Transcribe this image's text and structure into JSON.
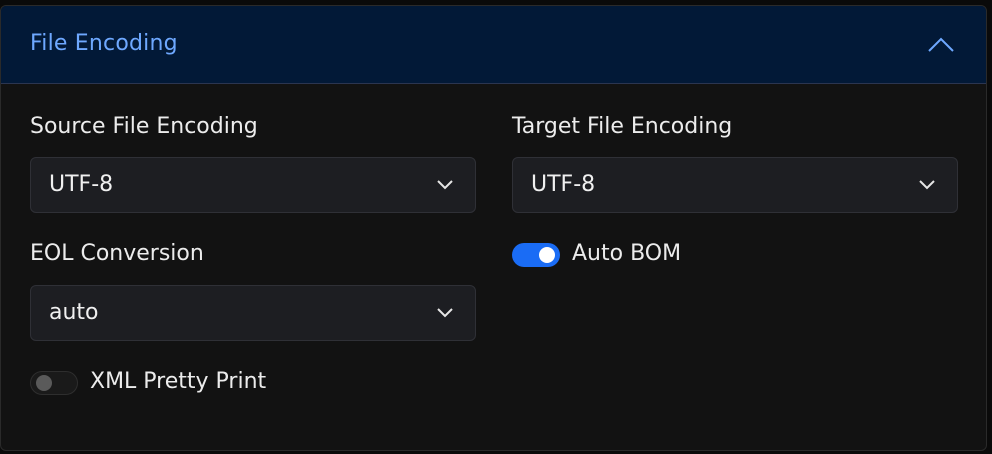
{
  "section": {
    "title": "File Encoding",
    "collapse_icon": "chevron-up-icon"
  },
  "fields": {
    "source_encoding": {
      "label": "Source File Encoding",
      "value": "UTF-8"
    },
    "target_encoding": {
      "label": "Target File Encoding",
      "value": "UTF-8"
    },
    "eol_conversion": {
      "label": "EOL Conversion",
      "value": "auto"
    },
    "auto_bom": {
      "label": "Auto BOM",
      "enabled": true
    },
    "xml_pretty_print": {
      "label": "XML Pretty Print",
      "enabled": false
    }
  },
  "colors": {
    "header_background": "#021937",
    "title_color": "#6ea8ff",
    "toggle_on": "#1a6cf5"
  }
}
